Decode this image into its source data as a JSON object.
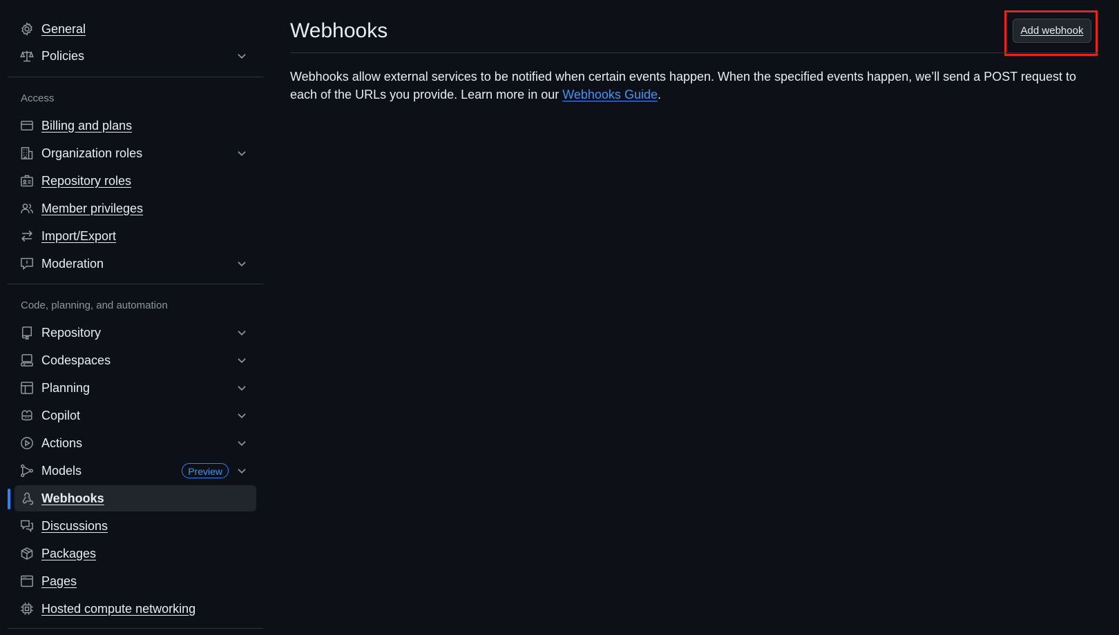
{
  "sidebar": {
    "top_items": [
      {
        "label": "General",
        "icon": "gear-icon",
        "link": true,
        "expandable": false
      },
      {
        "label": "Policies",
        "icon": "law-icon",
        "link": false,
        "expandable": true
      }
    ],
    "access_heading": "Access",
    "access_items": [
      {
        "label": "Billing and plans",
        "icon": "credit-card-icon",
        "link": true,
        "expandable": false
      },
      {
        "label": "Organization roles",
        "icon": "organization-icon",
        "link": false,
        "expandable": true
      },
      {
        "label": "Repository roles",
        "icon": "id-badge-icon",
        "link": true,
        "expandable": false
      },
      {
        "label": "Member privileges",
        "icon": "people-icon",
        "link": true,
        "expandable": false
      },
      {
        "label": "Import/Export",
        "icon": "arrow-switch-icon",
        "link": true,
        "expandable": false
      },
      {
        "label": "Moderation",
        "icon": "report-icon",
        "link": false,
        "expandable": true
      }
    ],
    "code_heading": "Code, planning, and automation",
    "code_items": [
      {
        "label": "Repository",
        "icon": "repo-icon",
        "link": false,
        "expandable": true
      },
      {
        "label": "Codespaces",
        "icon": "codespaces-icon",
        "link": false,
        "expandable": true
      },
      {
        "label": "Planning",
        "icon": "table-icon",
        "link": false,
        "expandable": true
      },
      {
        "label": "Copilot",
        "icon": "copilot-icon",
        "link": false,
        "expandable": true
      },
      {
        "label": "Actions",
        "icon": "play-icon",
        "link": false,
        "expandable": true
      },
      {
        "label": "Models",
        "icon": "models-icon",
        "link": false,
        "expandable": true,
        "badge": "Preview"
      },
      {
        "label": "Webhooks",
        "icon": "webhook-icon",
        "link": true,
        "expandable": false,
        "active": true
      },
      {
        "label": "Discussions",
        "icon": "comment-discussion-icon",
        "link": true,
        "expandable": false
      },
      {
        "label": "Packages",
        "icon": "package-icon",
        "link": true,
        "expandable": false
      },
      {
        "label": "Pages",
        "icon": "browser-icon",
        "link": true,
        "expandable": false
      },
      {
        "label": "Hosted compute networking",
        "icon": "cpu-icon",
        "link": true,
        "expandable": false
      }
    ]
  },
  "main": {
    "title": "Webhooks",
    "add_button_label": "Add webhook",
    "description_text": "Webhooks allow external services to be notified when certain events happen. When the specified events happen, we’ll send a POST request to each of the URLs you provide. Learn more in our ",
    "description_link": "Webhooks Guide",
    "description_end": "."
  },
  "colors": {
    "background": "#0d1117",
    "text": "#e6edf3",
    "muted": "#8d96a0",
    "accent": "#2f81f7",
    "link": "#4493f8",
    "highlight": "#e5251b"
  }
}
